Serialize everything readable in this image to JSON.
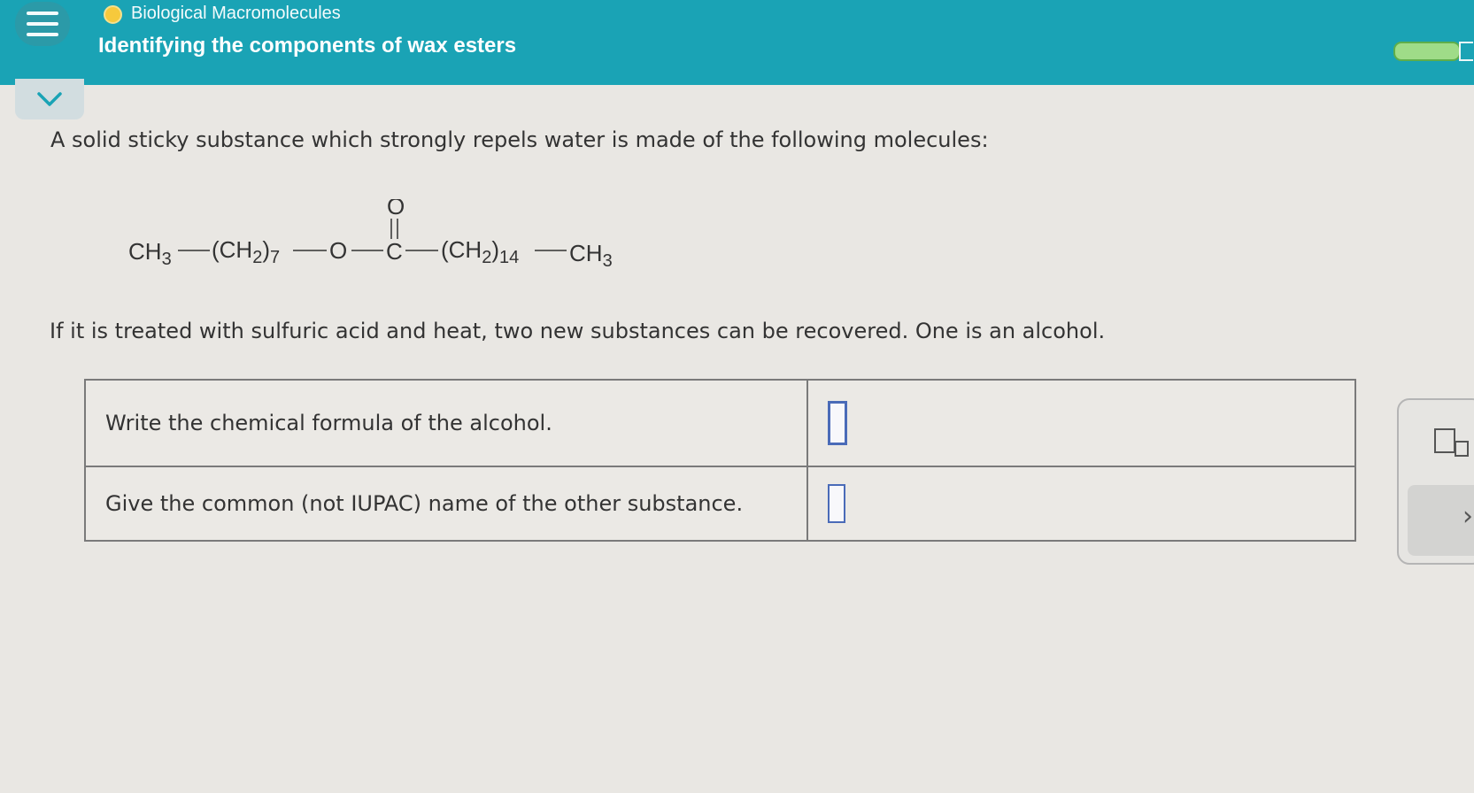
{
  "header": {
    "topic": "Biological Macromolecules",
    "title": "Identifying the components of wax esters",
    "menu_icon": "hamburger-menu-icon",
    "progress_fraction": 0.85
  },
  "question": {
    "intro": "A solid sticky substance which strongly repels water is made of the following molecules:",
    "followup": "If it is treated with sulfuric acid and heat, two new substances can be recovered. One is an alcohol."
  },
  "formula": {
    "left_methyl": "CH",
    "left_methyl_sub": "3",
    "chain1": "(CH",
    "chain1_sub_h": "2",
    "chain1_sub_n": "7",
    "ester_o": "O",
    "carbonyl_c": "C",
    "carbonyl_o": "O",
    "chain2": "(CH",
    "chain2_sub_h": "2",
    "chain2_sub_n": "14",
    "right_methyl": "CH",
    "right_methyl_sub": "3"
  },
  "table": {
    "rows": [
      {
        "prompt": "Write the chemical formula of the alcohol.",
        "answer": ""
      },
      {
        "prompt": "Give the common (not IUPAC) name of the other substance.",
        "answer": ""
      }
    ]
  },
  "colors": {
    "header_bg": "#1aa3b5",
    "page_bg": "#e9e7e3",
    "answer_box": "#4a6bb8",
    "progress_fill": "#9fdc88"
  }
}
